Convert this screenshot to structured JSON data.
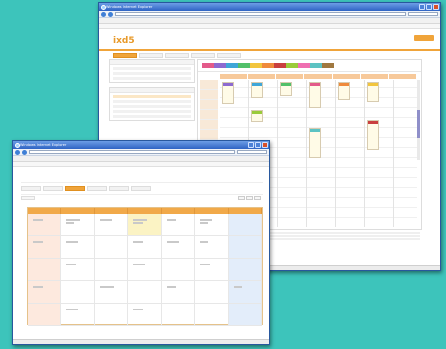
{
  "window_back": {
    "title": "Windows Internet Explorer",
    "logo": "ixd5",
    "header_right": "",
    "tabs": [
      "",
      "",
      "",
      "",
      ""
    ],
    "colors": {
      "accent": "#f0a43a",
      "bg": "#3dc4bb"
    }
  },
  "window_front": {
    "title": "Windows Internet Explorer",
    "tabs": [
      "",
      "",
      "",
      "",
      "",
      ""
    ],
    "weekday_headers": [
      "",
      "",
      "",
      "",
      "",
      "",
      ""
    ]
  }
}
